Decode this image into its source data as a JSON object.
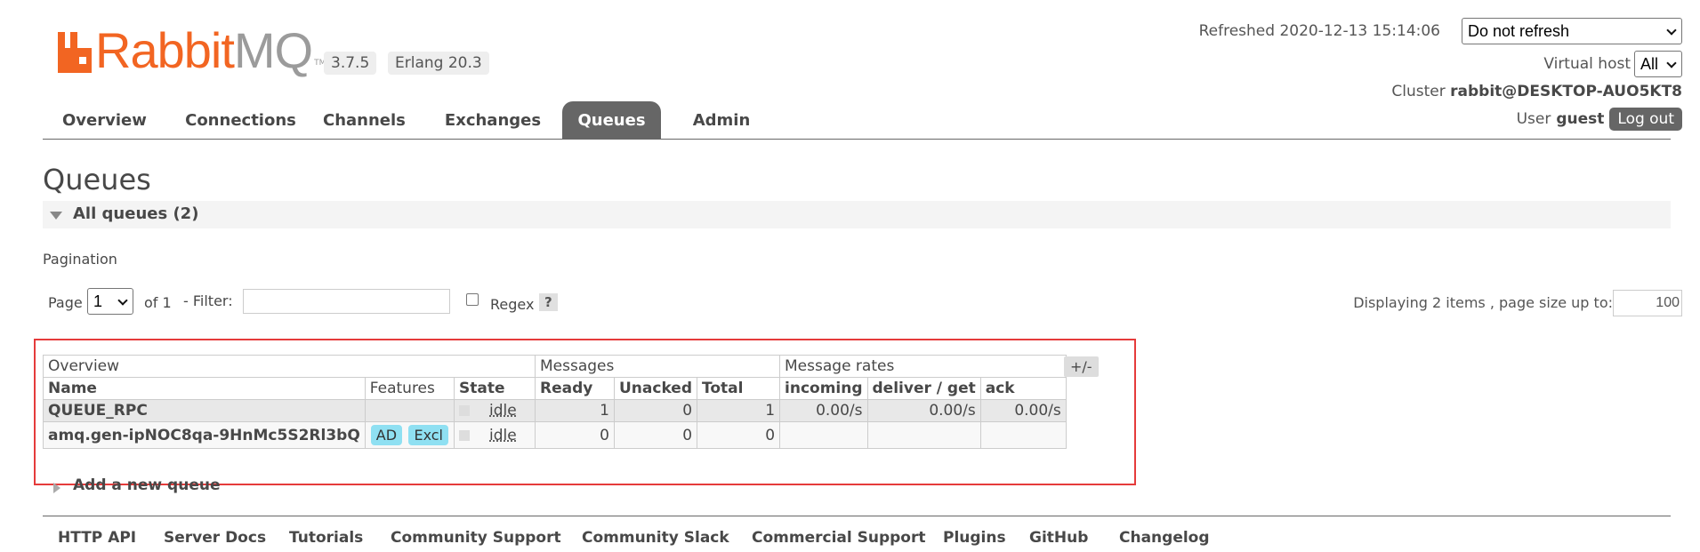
{
  "header": {
    "logo_text_a": "Rabbit",
    "logo_text_b": "MQ",
    "logo_tm": "TM",
    "version": "3.7.5",
    "erlang": "Erlang 20.3",
    "refreshed_label": "Refreshed 2020-12-13 15:14:06",
    "refresh_select": "Do not refresh",
    "vhost_label": "Virtual host",
    "vhost_select": "All",
    "cluster_label": "Cluster",
    "cluster_value": "rabbit@DESKTOP-AUO5KT8",
    "user_label": "User",
    "user_value": "guest",
    "logout": "Log out"
  },
  "tabs": [
    "Overview",
    "Connections",
    "Channels",
    "Exchanges",
    "Queues",
    "Admin"
  ],
  "active_tab": "Queues",
  "page_title": "Queues",
  "section_title": "All queues (2)",
  "pagination": {
    "label": "Pagination",
    "page_label": "Page",
    "page_value": "1",
    "of_label": "of 1",
    "filter_label": "- Filter:",
    "filter_value": "",
    "regex_label": "Regex",
    "regex_help": "?",
    "display_label": "Displaying 2 items , page size up to:",
    "page_size": "100"
  },
  "table": {
    "groups": [
      "Overview",
      "Messages",
      "Message rates"
    ],
    "plusminus": "+/-",
    "columns": [
      "Name",
      "Features",
      "State",
      "Ready",
      "Unacked",
      "Total",
      "incoming",
      "deliver / get",
      "ack"
    ],
    "rows": [
      {
        "name": "QUEUE_RPC",
        "features": [],
        "state": "idle",
        "ready": "1",
        "unacked": "0",
        "total": "1",
        "incoming": "0.00/s",
        "deliver": "0.00/s",
        "ack": "0.00/s"
      },
      {
        "name": "amq.gen-ipNOC8qa-9HnMc5S2Rl3bQ",
        "features": [
          "AD",
          "Excl"
        ],
        "state": "idle",
        "ready": "0",
        "unacked": "0",
        "total": "0",
        "incoming": "",
        "deliver": "",
        "ack": ""
      }
    ]
  },
  "add_queue": "Add a new queue",
  "footer": [
    "HTTP API",
    "Server Docs",
    "Tutorials",
    "Community Support",
    "Community Slack",
    "Commercial Support",
    "Plugins",
    "GitHub",
    "Changelog"
  ],
  "colors": {
    "brand_orange": "#f26522",
    "tab_active": "#666666",
    "feature_badge": "#8fe0f2",
    "highlight": "#e53b3b"
  }
}
